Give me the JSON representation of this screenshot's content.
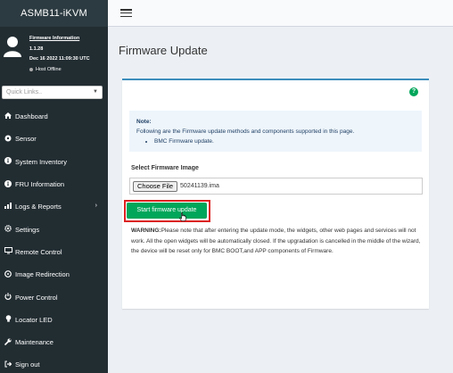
{
  "app": {
    "brand": "ASMB11-iKVM"
  },
  "user": {
    "firmware_link": "Firmware Information",
    "version": "1.1.28",
    "build_date": "Dec 16 2022 11:09:30 UTC",
    "host_status": "Host Offline"
  },
  "quick_links": {
    "placeholder": "Quick Links.."
  },
  "sidebar": {
    "items": [
      {
        "label": "Dashboard",
        "icon": "dashboard-icon"
      },
      {
        "label": "Sensor",
        "icon": "sensor-icon"
      },
      {
        "label": "System Inventory",
        "icon": "info-icon"
      },
      {
        "label": "FRU Information",
        "icon": "info-icon"
      },
      {
        "label": "Logs & Reports",
        "icon": "chart-icon",
        "has_submenu": true
      },
      {
        "label": "Settings",
        "icon": "gear-icon"
      },
      {
        "label": "Remote Control",
        "icon": "monitor-icon"
      },
      {
        "label": "Image Redirection",
        "icon": "image-icon"
      },
      {
        "label": "Power Control",
        "icon": "power-icon"
      },
      {
        "label": "Locator LED",
        "icon": "bulb-icon"
      },
      {
        "label": "Maintenance",
        "icon": "wrench-icon"
      },
      {
        "label": "Sign out",
        "icon": "sign-out-icon"
      }
    ]
  },
  "main": {
    "title": "Firmware Update",
    "help_icon": "?",
    "note": {
      "title": "Note:",
      "text": "Following are the Firmware update methods and components supported in this page.",
      "bullet": "BMC Firmware update."
    },
    "select_label": "Select Firmware Image",
    "choose_file_label": "Choose File",
    "file_name": "50241139.ima",
    "start_button": "Start firmware update",
    "warning_title": "WARNING:",
    "warning_text": "Please note that after entering the update mode, the widgets, other web pages and services will not work. All the open widgets will be automatically closed. If the upgradation is cancelled in the middle of the wizard, the device will be reset only for BMC BOOT,and APP components of Firmware."
  },
  "colors": {
    "sidebar_bg": "#222d32",
    "accent": "#3c8dbc",
    "success": "#00a65a",
    "highlight": "#dd2222"
  }
}
